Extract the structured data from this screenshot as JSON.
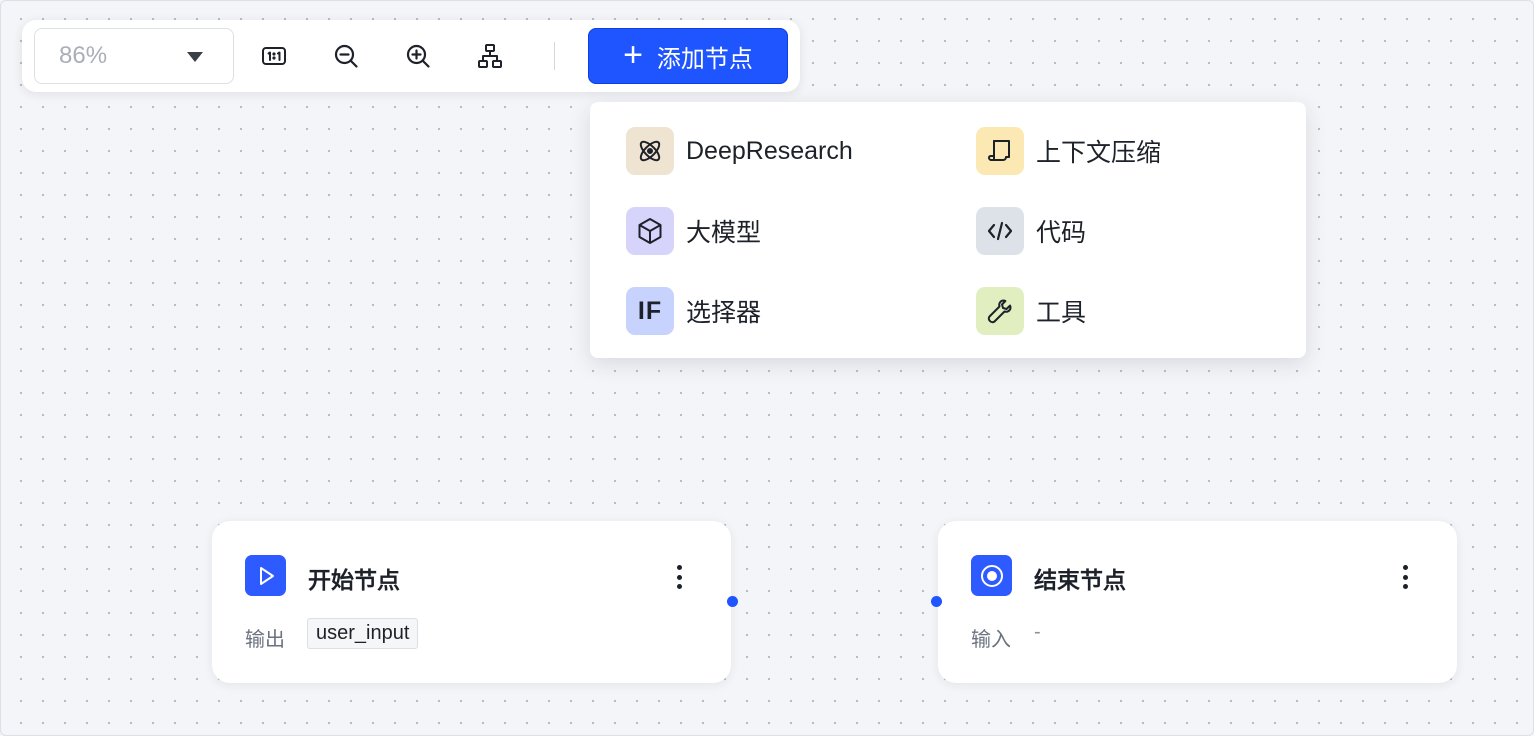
{
  "toolbar": {
    "zoom_value": "86%",
    "add_node_label": "添加节点",
    "add_icon": "plus-icon",
    "tool_icons": [
      "fit-1to1-icon",
      "zoom-out-icon",
      "zoom-in-icon",
      "auto-layout-icon"
    ]
  },
  "add_menu": {
    "items": [
      {
        "label": "DeepResearch",
        "icon": "atom-icon",
        "icon_bg": "#efe3d2"
      },
      {
        "label": "上下文压缩",
        "icon": "scroll-icon",
        "icon_bg": "#fbe8b3"
      },
      {
        "label": "大模型",
        "icon": "cube-icon",
        "icon_bg": "#d6d4fa"
      },
      {
        "label": "代码",
        "icon": "code-icon",
        "icon_bg": "#dde1e8"
      },
      {
        "label": "选择器",
        "icon": "if-icon",
        "icon_text": "IF",
        "icon_bg": "#c7d2fd"
      },
      {
        "label": "工具",
        "icon": "wrench-icon",
        "icon_bg": "#e1efc0"
      }
    ]
  },
  "nodes": {
    "start": {
      "title": "开始节点",
      "icon": "play-icon",
      "io_label": "输出",
      "variable": "user_input"
    },
    "end": {
      "title": "结束节点",
      "icon": "stop-circle-icon",
      "io_label": "输入",
      "value": "-"
    }
  },
  "colors": {
    "accent": "#1f55ff",
    "node_icon_bg": "#2d5bff",
    "canvas_bg": "#f4f5f8",
    "canvas_dot": "#b9bdc6"
  }
}
